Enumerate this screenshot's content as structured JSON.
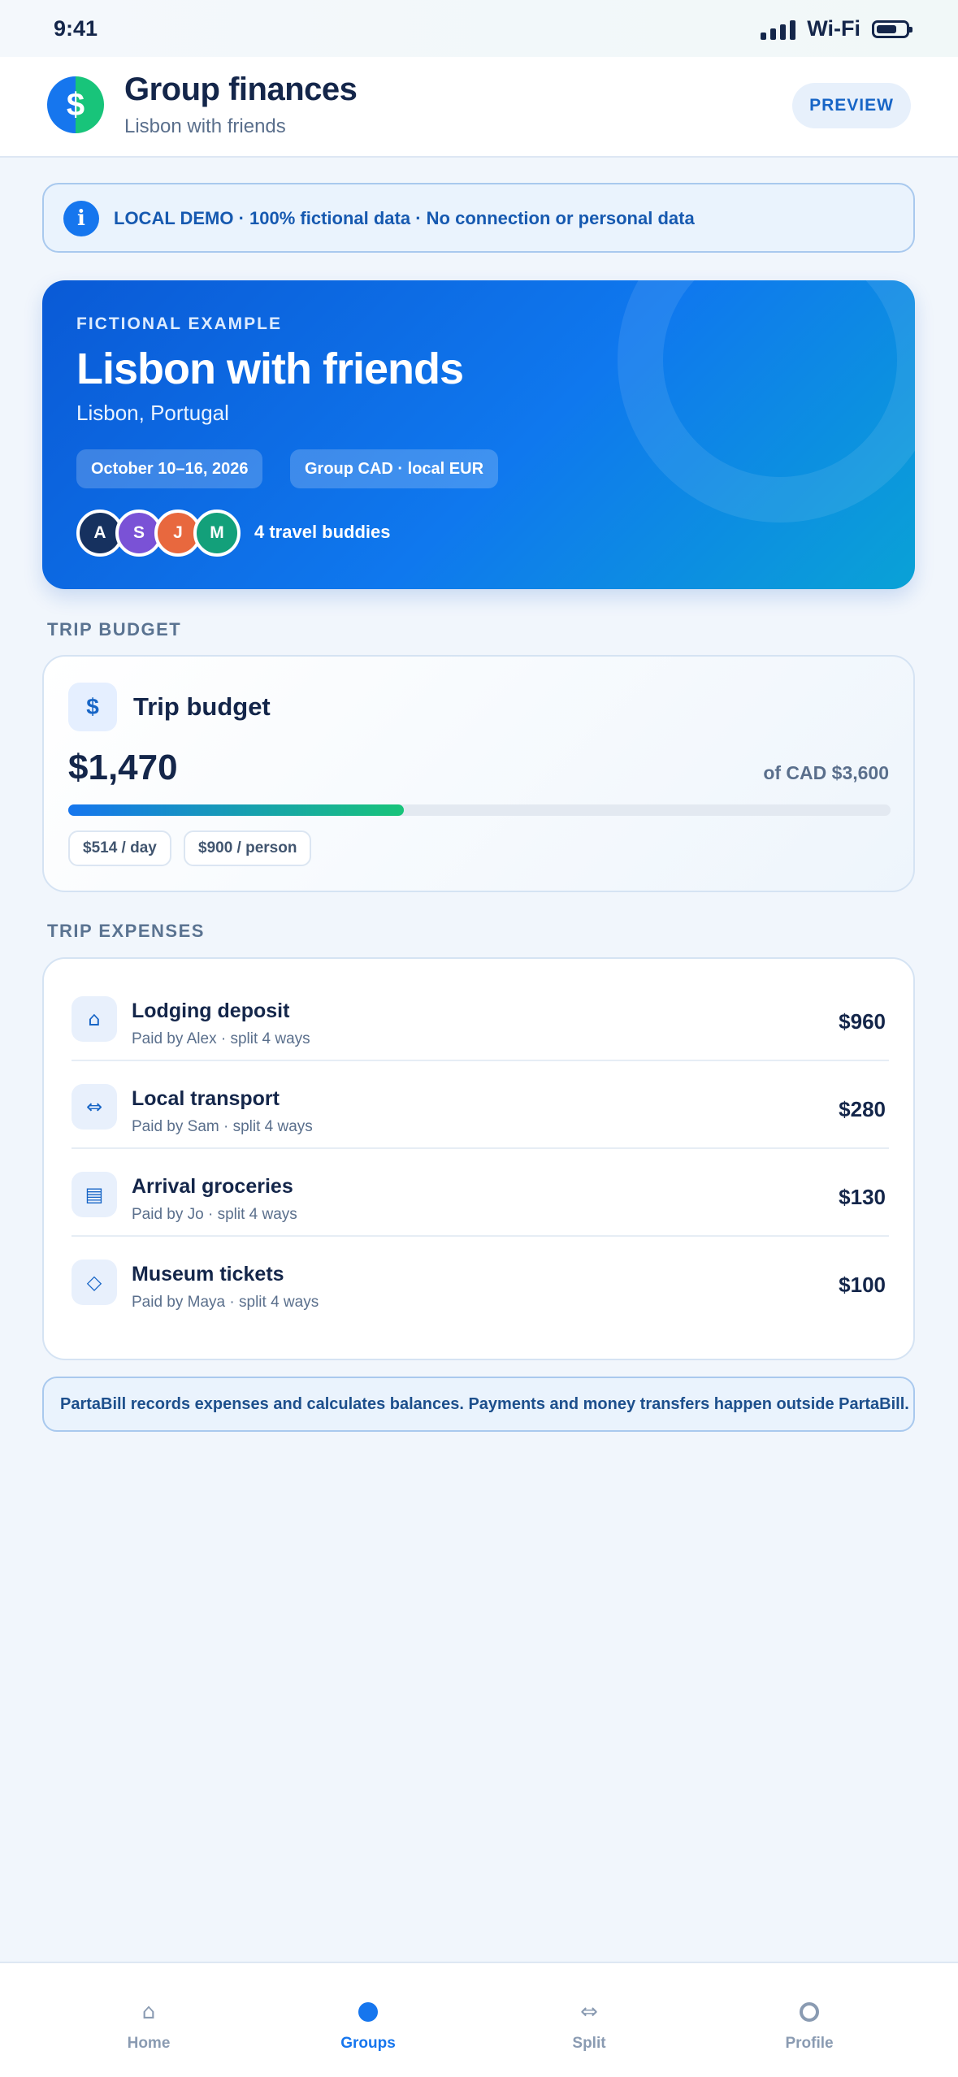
{
  "status_bar": {
    "time": "9:41",
    "network": "Wi-Fi"
  },
  "header": {
    "logo_symbol": "$",
    "title": "Group finances",
    "subtitle": "Lisbon with friends",
    "preview_label": "PREVIEW"
  },
  "demo_banner": {
    "icon": "i",
    "text": "LOCAL DEMO · 100% fictional data · No connection or personal data"
  },
  "trip": {
    "eyebrow": "FICTIONAL EXAMPLE",
    "title": "Lisbon with friends",
    "location": "Lisbon, Portugal",
    "dates": "October 10–16, 2026",
    "currency": "Group CAD · local EUR",
    "buddies": [
      {
        "initial": "A",
        "color": "#16315f"
      },
      {
        "initial": "S",
        "color": "#7a52d6"
      },
      {
        "initial": "J",
        "color": "#e8683e"
      },
      {
        "initial": "M",
        "color": "#13a07a"
      }
    ],
    "buddies_label": "4 travel buddies"
  },
  "budget": {
    "section_label": "TRIP BUDGET",
    "icon_symbol": "$",
    "title": "Trip budget",
    "spent": "$1,470",
    "total": "of CAD $3,600",
    "progress_fraction": 0.408,
    "per_day": "$514 / day",
    "per_person": "$900 / person"
  },
  "expenses": {
    "section_label": "TRIP EXPENSES",
    "items": [
      {
        "icon": "home-icon",
        "glyph": "⌂",
        "name": "Lodging deposit",
        "meta": "Paid by Alex · split 4 ways",
        "amount": "$960"
      },
      {
        "icon": "transport-icon",
        "glyph": "⇔",
        "name": "Local transport",
        "meta": "Paid by Sam · split 4 ways",
        "amount": "$280"
      },
      {
        "icon": "groceries-icon",
        "glyph": "▤",
        "name": "Arrival groceries",
        "meta": "Paid by Jo · split 4 ways",
        "amount": "$130"
      },
      {
        "icon": "ticket-icon",
        "glyph": "◇",
        "name": "Museum tickets",
        "meta": "Paid by Maya · split 4 ways",
        "amount": "$100"
      }
    ]
  },
  "footnote": "PartaBill records expenses and calculates balances. Payments and money transfers happen outside PartaBill.",
  "tabs": [
    {
      "label": "Home",
      "icon": "home-icon",
      "glyph": "⌂",
      "active": false
    },
    {
      "label": "Groups",
      "icon": "groups-icon",
      "glyph": "",
      "active": true
    },
    {
      "label": "Split",
      "icon": "split-icon",
      "glyph": "⇔",
      "active": false
    },
    {
      "label": "Profile",
      "icon": "profile-icon",
      "glyph": "",
      "active": false
    }
  ],
  "colors": {
    "accent": "#1676ee",
    "accent_green": "#18c47a",
    "text_primary": "#14264a",
    "text_secondary": "#5a6f8c"
  }
}
